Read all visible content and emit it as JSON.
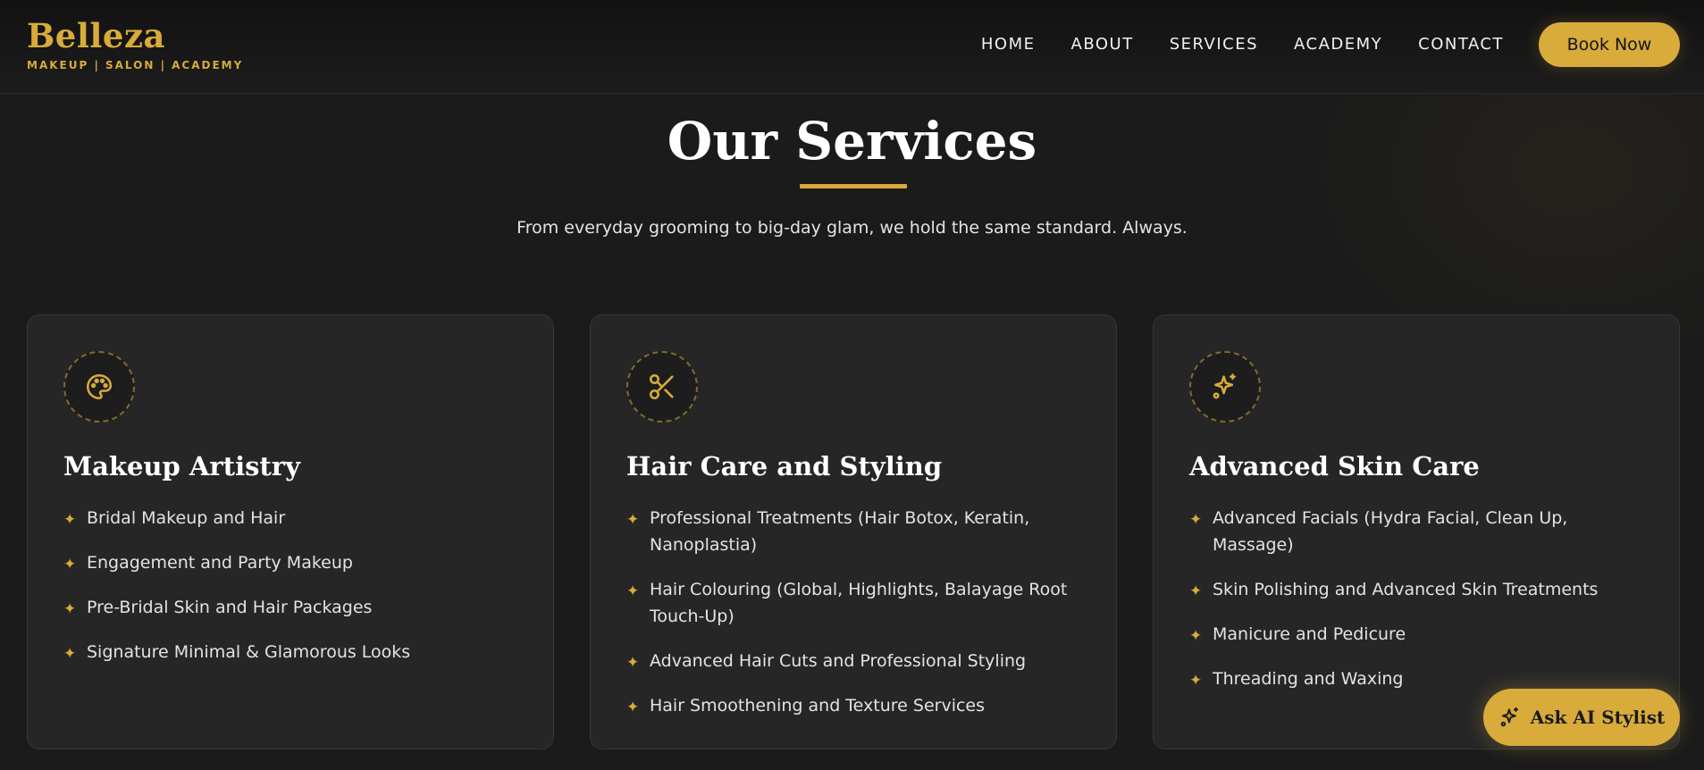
{
  "brand": {
    "name": "Belleza",
    "tagline": "MAKEUP | SALON | ACADEMY"
  },
  "nav": {
    "items": [
      "HOME",
      "ABOUT",
      "SERVICES",
      "ACADEMY",
      "CONTACT"
    ],
    "book_label": "Book Now"
  },
  "section": {
    "title": "Our Services",
    "subtitle": "From everyday grooming to big-day glam, we hold the same standard. Always."
  },
  "cards": [
    {
      "icon": "palette-icon",
      "title": "Makeup Artistry",
      "items": [
        "Bridal Makeup and Hair",
        "Engagement and Party Makeup",
        "Pre-Bridal Skin and Hair Packages",
        "Signature Minimal & Glamorous Looks"
      ]
    },
    {
      "icon": "scissors-icon",
      "title": "Hair Care and Styling",
      "items": [
        "Professional Treatments (Hair Botox, Keratin, Nanoplastia)",
        "Hair Colouring (Global, Highlights, Balayage Root Touch-Up)",
        "Advanced Hair Cuts and Professional Styling",
        "Hair Smoothening and Texture Services"
      ]
    },
    {
      "icon": "sparkles-icon",
      "title": "Advanced Skin Care",
      "items": [
        "Advanced Facials (Hydra Facial, Clean Up, Massage)",
        "Skin Polishing and Advanced Skin Treatments",
        "Manicure and Pedicure",
        "Threading and Waxing"
      ]
    }
  ],
  "ai_button": {
    "label": "Ask AI Stylist",
    "icon": "sparkles-icon"
  },
  "colors": {
    "accent": "#d8ab3a",
    "background": "#1b1b1b",
    "card": "#262626"
  }
}
